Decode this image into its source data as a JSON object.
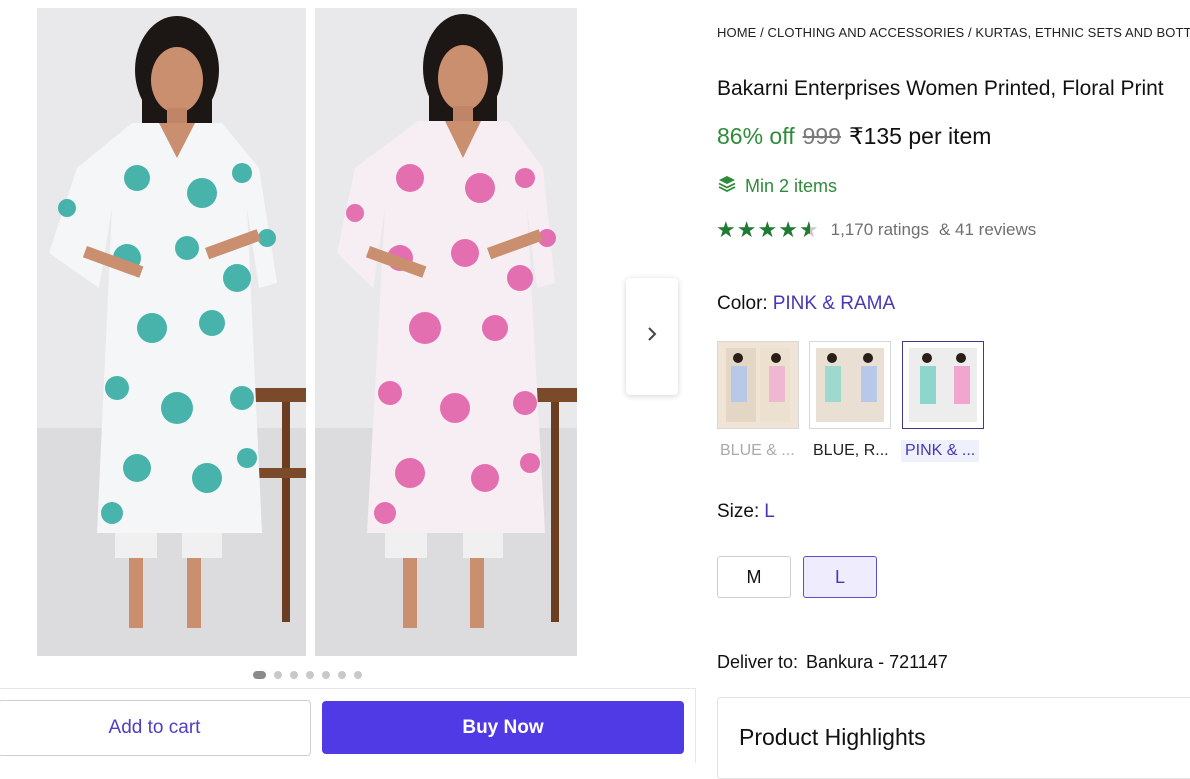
{
  "gallery": {
    "images": [
      {
        "color_theme": "teal floral kurta on model",
        "accent": "#2aa89e"
      },
      {
        "color_theme": "pink floral kurta on model",
        "accent": "#e05aa6"
      }
    ],
    "dots_total": 7,
    "dots_active": 1,
    "next_icon": "chevron-right-icon"
  },
  "actions": {
    "add_to_cart": "Add to cart",
    "buy_now": "Buy Now",
    "buy_color": "#4f3ae6"
  },
  "breadcrumb": {
    "items": [
      "HOME",
      "CLOTHING AND ACCESSORIES",
      "KURTAS, ETHNIC SETS AND BOTTOMS"
    ],
    "separator": " / "
  },
  "product": {
    "title": "Bakarni Enterprises Women Printed, Floral Print",
    "discount": "86% off",
    "mrp": "999",
    "price": "₹135 per item",
    "min_items": "Min 2 items",
    "rating": 4.4,
    "ratings_count": "1,170 ratings",
    "reviews_count": "& 41 reviews"
  },
  "color": {
    "label": "Color:",
    "selected": "PINK & RAMA",
    "options": [
      "BLUE & ...",
      "BLUE, R...",
      "PINK & ..."
    ]
  },
  "size": {
    "label": "Size:",
    "selected": "L",
    "options": [
      "M",
      "L"
    ]
  },
  "delivery": {
    "label": "Deliver to:",
    "location": "Bankura - 721147"
  },
  "highlights": {
    "title": "Product Highlights"
  }
}
